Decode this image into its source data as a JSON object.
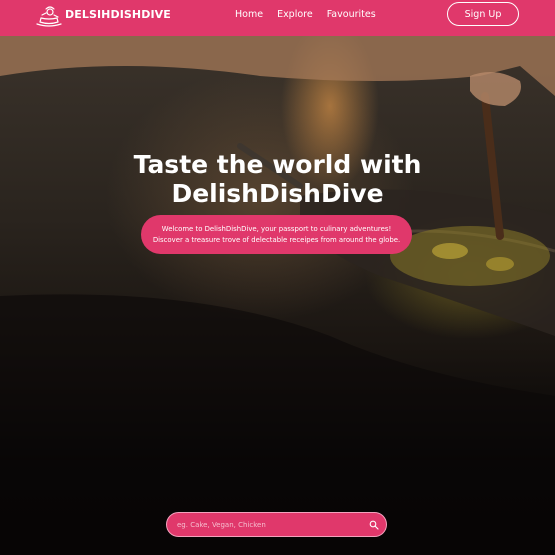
{
  "brand": {
    "name": "DELSIHDISHDIVE"
  },
  "nav": {
    "links": [
      "Home",
      "Explore",
      "Favourites"
    ],
    "signup_label": "Sign Up"
  },
  "hero": {
    "title_line1": "Taste the world with",
    "title_line2": "DelishDishDive",
    "tagline_line1": "Welcome to DelishDishDive, your passport to culinary adventures!",
    "tagline_line2": "Discover a treasure trove of delectable receipes from around the globe."
  },
  "search": {
    "placeholder": "eg. Cake, Vegan, Chicken"
  },
  "colors": {
    "accent": "#e0386b",
    "text": "#ffffff"
  },
  "icons": {
    "logo": "chef-cooking-icon",
    "search": "search-icon"
  }
}
